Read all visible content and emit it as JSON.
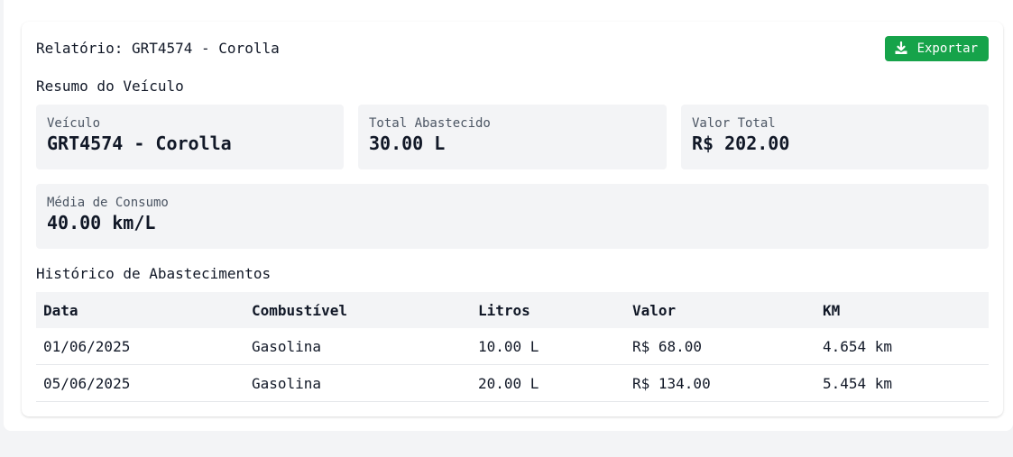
{
  "report": {
    "title": "Relatório: GRT4574 - Corolla",
    "export_label": "Exportar"
  },
  "summary": {
    "title": "Resumo do Veículo",
    "vehicle_label": "Veículo",
    "vehicle_value": "GRT4574 - Corolla",
    "total_fuel_label": "Total Abastecido",
    "total_fuel_value": "30.00 L",
    "total_value_label": "Valor Total",
    "total_value_value": "R$ 202.00",
    "avg_consumption_label": "Média de Consumo",
    "avg_consumption_value": "40.00 km/L"
  },
  "history": {
    "title": "Histórico de Abastecimentos",
    "columns": [
      "Data",
      "Combustível",
      "Litros",
      "Valor",
      "KM"
    ],
    "rows": [
      [
        "01/06/2025",
        "Gasolina",
        "10.00 L",
        "R$ 68.00",
        "4.654 km"
      ],
      [
        "05/06/2025",
        "Gasolina",
        "20.00 L",
        "R$ 134.00",
        "5.454 km"
      ]
    ]
  },
  "colors": {
    "accent": "#16a34a",
    "box_bg": "#f3f4f6",
    "page_bg": "#f3f4f6"
  },
  "icons": {
    "export": "download-icon"
  }
}
